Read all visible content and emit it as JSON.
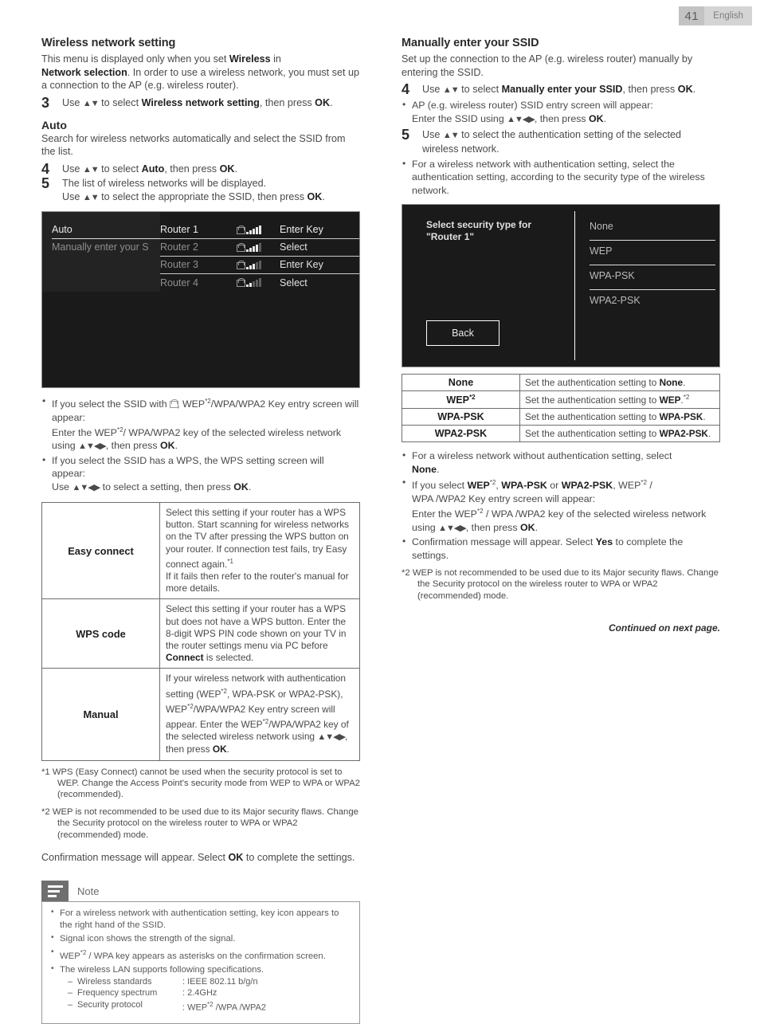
{
  "header": {
    "page_number": "41",
    "language": "English"
  },
  "left": {
    "section_title": "Wireless network setting",
    "intro_1": "This menu is displayed only when you set ",
    "intro_1_b": "Wireless",
    "intro_1_c": " in",
    "intro_2_b": "Network selection",
    "intro_2": ". In order to use a wireless network, you must set up a connection to the AP (e.g. wireless router).",
    "step3": {
      "num": "3",
      "pre": "Use ",
      "arrows": "▲▼",
      "mid": " to select ",
      "bold": "Wireless network setting",
      "post": ", then press ",
      "ok": "OK",
      "end": "."
    },
    "auto_title": "Auto",
    "auto_desc": "Search for wireless networks automatically and select the SSID from the list.",
    "step4": {
      "num": "4",
      "pre": "Use ",
      "arrows": "▲▼",
      "mid": " to select ",
      "bold": "Auto",
      "post": ", then press ",
      "ok": "OK",
      "end": "."
    },
    "step5": {
      "num": "5",
      "line1": "The list of wireless networks will be displayed.",
      "line2_pre": "Use ",
      "arrows": "▲▼",
      "line2_mid": " to select the appropriate the SSID, then press ",
      "ok": "OK",
      "end": "."
    },
    "tv_screen": {
      "menu_items": [
        {
          "label": "Auto",
          "active": true
        },
        {
          "label": "Manually enter your S",
          "active": false
        }
      ],
      "routers": [
        {
          "name": "Router 1",
          "action": "Enter Key",
          "signal": 5,
          "locked": true,
          "active": true
        },
        {
          "name": "Router 2",
          "action": "Select",
          "signal": 4,
          "locked": true,
          "active": false
        },
        {
          "name": "Router 3",
          "action": "Enter Key",
          "signal": 3,
          "locked": true,
          "active": false
        },
        {
          "name": "Router 4",
          "action": "Select",
          "signal": 2,
          "locked": true,
          "active": false
        }
      ]
    },
    "bullets": [
      {
        "l1a": "If you select the SSID with ",
        "lock": "🔒",
        "l1b": ", WEP",
        "fn": "*2",
        "l1c": "/WPA/WPA2 Key entry screen will appear:",
        "l2a": "Enter the WEP",
        "l2b": "/ WPA/WPA2 key of the selected wireless network using ",
        "arrows": "▲▼◀▶",
        "l2c": ", then press ",
        "ok": "OK",
        "end": "."
      },
      {
        "l1": "If you select the SSID has a WPS, the WPS setting screen will appear:",
        "l2a": "Use ",
        "arrows": "▲▼◀▶",
        "l2b": " to select a setting, then press ",
        "ok": "OK",
        "end": "."
      }
    ],
    "wps_table": [
      {
        "key": "Easy connect",
        "value": "Select this setting if your router has a WPS button. Start scanning for wireless networks on the TV after pressing the WPS button on your router. If connection test fails, try Easy connect again.*1 If it fails then refer to the router's manual for more details."
      },
      {
        "key": "WPS code",
        "value": "Select this setting if your router has a WPS but does not have a WPS button. Enter the 8-digit WPS PIN code shown on your TV in the router settings menu via PC before Connect is selected."
      },
      {
        "key": "Manual",
        "value": "If your wireless network with authentication setting (WEP*2, WPA-PSK or WPA2-PSK), WEP*2/WPA/WPA2 Key entry screen will appear. Enter the WEP*2/WPA/WPA2 key of the selected wireless network using ▲▼◀▶, then press OK."
      }
    ],
    "footnote1": "*1 WPS (Easy Connect) cannot be used when the security protocol is set to WEP. Change the Access Point's security mode from WEP to WPA or WPA2 (recommended).",
    "footnote2": "*2 WEP is not recommended to be used due to its Major security flaws. Change the Security protocol on the wireless router to WPA or WPA2 (recommended) mode.",
    "confirm_pre": "Confirmation message will appear. Select ",
    "confirm_ok": "OK",
    "confirm_post": " to complete the settings.",
    "note": {
      "title": "Note",
      "items": [
        "For a wireless network with authentication setting, key icon appears to the right hand of the SSID.",
        "Signal icon shows the strength of the signal.",
        "WEP*2 / WPA key appears as asterisks on the confirmation screen.",
        "The wireless LAN supports following specifications."
      ],
      "specs": [
        {
          "key": "Wireless standards",
          "value": ": IEEE 802.11 b/g/n"
        },
        {
          "key": "Frequency spectrum",
          "value": ": 2.4GHz"
        },
        {
          "key": "Security protocol",
          "value": ": WEP*2 /WPA /WPA2"
        }
      ]
    }
  },
  "right": {
    "section_title": "Manually enter your SSID",
    "intro": "Set up the connection to the AP (e.g. wireless router) manually by entering the SSID.",
    "step4": {
      "num": "4",
      "pre": "Use ",
      "arrows": "▲▼",
      "mid": " to select ",
      "bold": "Manually enter your SSID",
      "post": ", then press ",
      "ok": "OK",
      "end": "."
    },
    "step4_bullets": [
      {
        "l1": "AP (e.g. wireless router) SSID entry screen will appear:",
        "l2a": "Enter the SSID using ",
        "arrows": "▲▼◀▶",
        "l2b": ", then press ",
        "ok": "OK",
        "end": "."
      }
    ],
    "step5": {
      "num": "5",
      "pre": "Use ",
      "arrows": "▲▼",
      "post": " to select the authentication setting of the selected wireless network."
    },
    "step5_bullets": [
      "For a wireless network with authentication setting, select the authentication setting, according to the security type of the wireless network."
    ],
    "tv_screen": {
      "prompt_line1": "Select security type for",
      "prompt_line2": "\"Router 1\"",
      "back_button": "Back",
      "options": [
        "None",
        "WEP",
        "WPA-PSK",
        "WPA2-PSK"
      ]
    },
    "auth_table": [
      {
        "key": "None",
        "key_fn": "",
        "pre": "Set the authentication setting to ",
        "bold": "None",
        "post": "."
      },
      {
        "key": "WEP",
        "key_fn": "*2",
        "pre": "Set the authentication setting to ",
        "bold": "WEP",
        "post": ".*2"
      },
      {
        "key": "WPA-PSK",
        "key_fn": "",
        "pre": "Set the authentication setting to ",
        "bold": "WPA-PSK",
        "post": "."
      },
      {
        "key": "WPA2-PSK",
        "key_fn": "",
        "pre": "Set the authentication setting to ",
        "bold": "WPA2-PSK",
        "post": "."
      }
    ],
    "bullets": [
      {
        "l1a": "For a wireless network without authentication setting, select ",
        "b1": "None",
        "l1b": "."
      },
      {
        "l1a": "If you select ",
        "b1": "WEP",
        "fn1": "*2",
        "l1b": ", ",
        "b2": "WPA-PSK",
        "l1c": " or ",
        "b3": "WPA2-PSK",
        "l1d": ", WEP*2 / WPA /WPA2 Key entry screen will appear:",
        "l2a": "Enter the WEP*2 / WPA /WPA2 key of the selected wireless network using ",
        "arrows": "▲▼◀▶",
        "l2b": ", then press ",
        "ok": "OK",
        "end": "."
      },
      {
        "l1a": "Confirmation message will appear. Select ",
        "b1": "Yes",
        "l1b": " to complete the settings."
      }
    ],
    "footnote2": "*2 WEP is not recommended to be used due to its Major security flaws. Change the Security protocol on the wireless router to WPA or WPA2 (recommended) mode.",
    "continued": "Continued on next page."
  }
}
